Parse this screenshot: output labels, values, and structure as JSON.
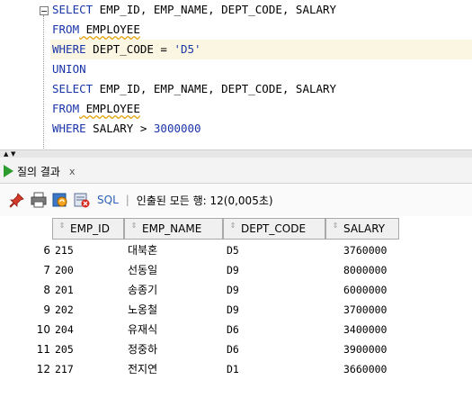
{
  "editor": {
    "lines": [
      {
        "kw1": "SELECT",
        "rest": " EMP_ID, EMP_NAME, DEPT_CODE, SALARY"
      },
      {
        "kw1": "FROM",
        "rest": " EMPLOYEE"
      },
      {
        "kw1": "WHERE",
        "rest": " DEPT_CODE = ",
        "literal": "'D5'"
      },
      {
        "kw1": "UNION",
        "rest": ""
      },
      {
        "kw1": "SELECT",
        "rest": " EMP_ID, EMP_NAME, DEPT_CODE, SALARY"
      },
      {
        "kw1": "FROM",
        "rest": " EMPLOYEE"
      },
      {
        "kw1": "WHERE",
        "rest": " SALARY > ",
        "literal": "3000000"
      }
    ]
  },
  "results_tab": {
    "label": "질의 결과",
    "close": "x"
  },
  "toolbar": {
    "sql_label": "SQL",
    "separator": "|",
    "status": "인출된 모든 행: 12(0,005초)"
  },
  "columns": [
    "EMP_ID",
    "EMP_NAME",
    "DEPT_CODE",
    "SALARY"
  ],
  "rows": [
    {
      "n": "6",
      "emp_id": "215",
      "name": "대북혼",
      "dept": "D5",
      "salary": "3760000"
    },
    {
      "n": "7",
      "emp_id": "200",
      "name": "선동일",
      "dept": "D9",
      "salary": "8000000"
    },
    {
      "n": "8",
      "emp_id": "201",
      "name": "송종기",
      "dept": "D9",
      "salary": "6000000"
    },
    {
      "n": "9",
      "emp_id": "202",
      "name": "노옹철",
      "dept": "D9",
      "salary": "3700000"
    },
    {
      "n": "10",
      "emp_id": "204",
      "name": "유재식",
      "dept": "D6",
      "salary": "3400000"
    },
    {
      "n": "11",
      "emp_id": "205",
      "name": "정중하",
      "dept": "D6",
      "salary": "3900000"
    },
    {
      "n": "12",
      "emp_id": "217",
      "name": "전지연",
      "dept": "D1",
      "salary": "3660000"
    }
  ],
  "colors": {
    "keyword": "#1a35a8",
    "current_line": "#fbf6e1",
    "run_icon": "#2e9b2e",
    "link": "#2a5fb5"
  }
}
